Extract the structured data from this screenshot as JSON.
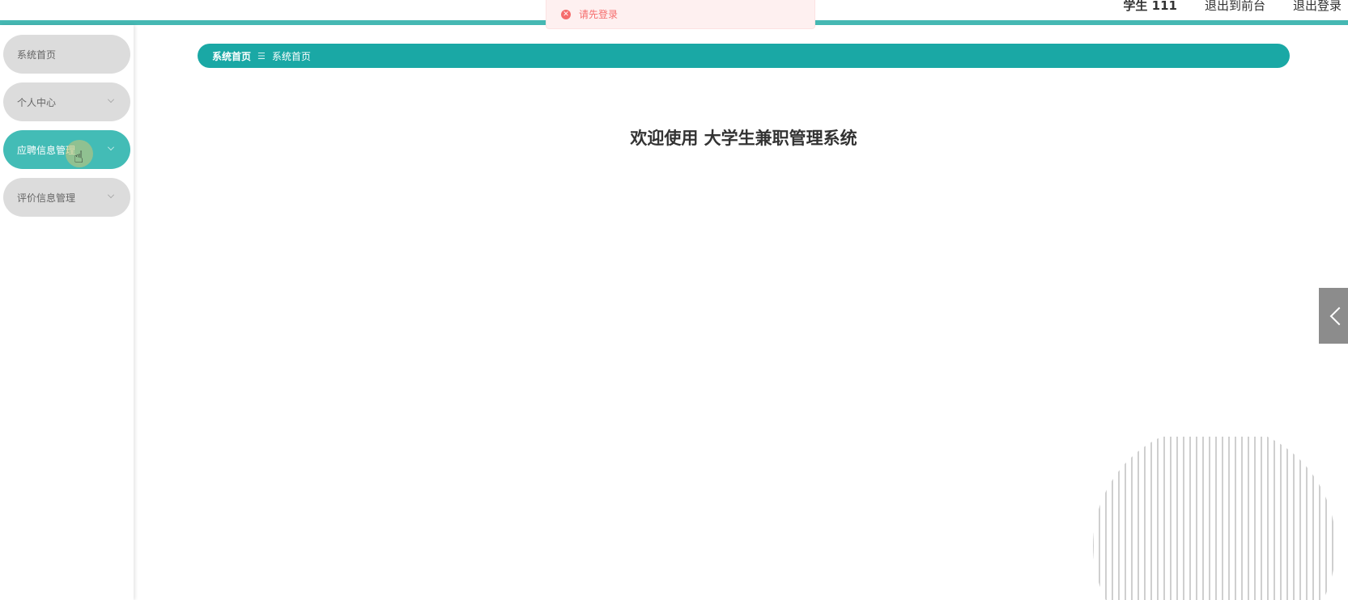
{
  "toast": {
    "icon": "error-circle-icon",
    "message": "请先登录",
    "color": "#f56c6c"
  },
  "header": {
    "user": "学生 111",
    "links": [
      "退出到前台",
      "退出登录"
    ],
    "accent": "#45b8b3"
  },
  "sidebar": {
    "items": [
      {
        "label": "系统首页",
        "has_submenu": false,
        "active": false
      },
      {
        "label": "个人中心",
        "has_submenu": true,
        "active": false
      },
      {
        "label": "应聘信息管理",
        "has_submenu": true,
        "active": true
      },
      {
        "label": "评价信息管理",
        "has_submenu": true,
        "active": false
      }
    ],
    "active_color": "#43bcb6",
    "inactive_color": "#dcdcdc"
  },
  "breadcrumb": {
    "items": [
      "系统首页",
      "系统首页"
    ],
    "separator_icon": "menu-lines-icon",
    "color": "#1aa8a5"
  },
  "main": {
    "welcome_title": "欢迎使用 大学生兼职管理系统"
  },
  "side_tab": {
    "icon": "chevron-left-icon"
  }
}
